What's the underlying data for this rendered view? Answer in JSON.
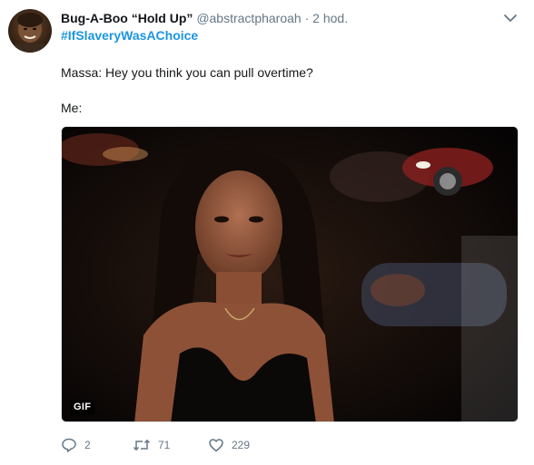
{
  "tweet": {
    "display_name": "Bug-A-Boo “Hold Up”",
    "handle": "@abstractpharoah",
    "separator": "·",
    "time": "2 hod.",
    "hashtag": "#IfSlaveryWasAChoice",
    "lines": [
      "Massa: Hey you think you can pull overtime?",
      "Me:"
    ],
    "media_badge": "GIF",
    "actions": {
      "reply_count": "2",
      "retweet_count": "71",
      "like_count": "229"
    }
  },
  "icons": {
    "menu": "chevron-down-icon",
    "reply": "reply-icon",
    "retweet": "retweet-icon",
    "like": "heart-icon"
  },
  "colors": {
    "link": "#1b95e0",
    "secondary_text": "#657786",
    "primary_text": "#14171a"
  }
}
